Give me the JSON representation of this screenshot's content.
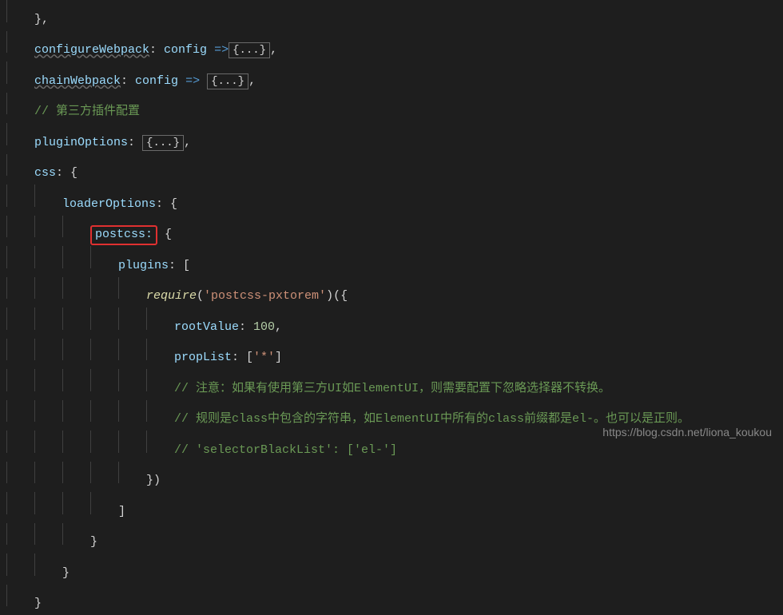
{
  "code": {
    "l1_brace": "}",
    "l1_comma": ",",
    "l2_prop": "configureWebpack",
    "l2_colon": ": ",
    "l2_param": "config",
    "l2_arrow": " =>",
    "l2_folded": "{...}",
    "l2_comma": ",",
    "l3_prop": "chainWebpack",
    "l3_colon": ": ",
    "l3_param": "config",
    "l3_arrow": " => ",
    "l3_folded": "{...}",
    "l3_comma": ",",
    "l4_comment": "// 第三方插件配置",
    "l5_prop": "pluginOptions",
    "l5_colon": ": ",
    "l5_folded": "{...}",
    "l5_comma": ",",
    "l6_prop": "css",
    "l6_colon": ": ",
    "l6_brace": "{",
    "l7_prop": "loaderOptions",
    "l7_colon": ": ",
    "l7_brace": "{",
    "l8_prop": "postcss:",
    "l8_brace": " {",
    "l9_prop": "plugins",
    "l9_colon": ": ",
    "l9_bracket": "[",
    "l10_func": "require",
    "l10_p1": "(",
    "l10_str": "'postcss-pxtorem'",
    "l10_p2": ")({",
    "l11_prop": "rootValue",
    "l11_colon": ": ",
    "l11_num": "100",
    "l11_comma": ",",
    "l12_prop": "propList",
    "l12_colon": ": [",
    "l12_str": "'*'",
    "l12_close": "]",
    "l13_comment": "// 注意：如果有使用第三方UI如ElementUI，则需要配置下忽略选择器不转换。",
    "l14_comment": "// 规则是class中包含的字符串，如ElementUI中所有的class前缀都是el-。也可以是正则。",
    "l15_comment": "// 'selectorBlackList': ['el-']",
    "l16_close": "})",
    "l17_close": "]",
    "l18_close": "}",
    "l19_close": "}",
    "l20_close": "}"
  },
  "watermark": "https://blog.csdn.net/liona_koukou"
}
